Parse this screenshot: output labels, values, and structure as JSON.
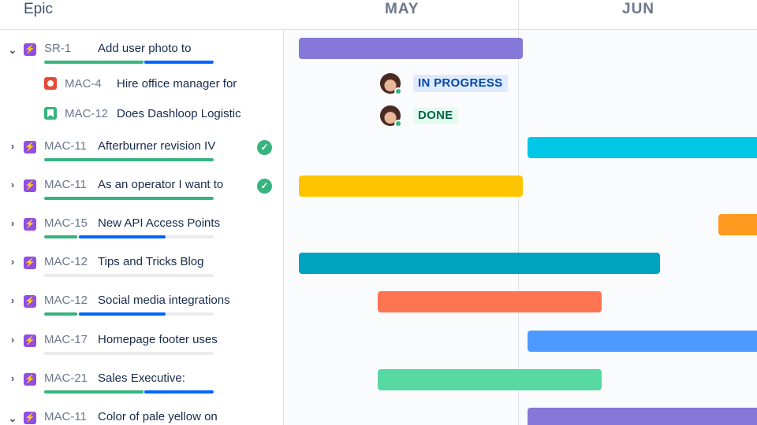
{
  "header": {
    "epic_title": "Epic",
    "months": [
      "MAY",
      "JUN"
    ]
  },
  "colors": {
    "purple": "#8777d9",
    "cyan": "#00c7e6",
    "yellow": "#ffc400",
    "orange": "#ff991f",
    "teal": "#00a3bf",
    "coral": "#ff7452",
    "blue": "#4c9aff",
    "green": "#57d9a3"
  },
  "rows": [
    {
      "key": "SR-1",
      "summary": "Add user photo to",
      "expanded": true,
      "check": false
    },
    {
      "key": "MAC-4",
      "summary": "Hire office manager for",
      "type": "bug",
      "avatar": "avatar",
      "status": "IN PROGRESS"
    },
    {
      "key": "MAC-12",
      "summary": "Does Dashloop Logistic",
      "type": "story",
      "avatar": "avatar",
      "status": "DONE"
    },
    {
      "key": "MAC-11",
      "summary": "Afterburner revision IV",
      "expanded": false,
      "check": true
    },
    {
      "key": "MAC-11",
      "summary": "As an operator I want to",
      "expanded": false,
      "check": true
    },
    {
      "key": "MAC-15",
      "summary": "New API Access Points",
      "expanded": false,
      "check": false
    },
    {
      "key": "MAC-12",
      "summary": "Tips and Tricks Blog",
      "expanded": false,
      "check": false
    },
    {
      "key": "MAC-12",
      "summary": "Social media integrations",
      "expanded": false,
      "check": false
    },
    {
      "key": "MAC-17",
      "summary": "Homepage footer uses",
      "expanded": false,
      "check": false
    },
    {
      "key": "MAC-21",
      "summary": "Sales Executive:",
      "expanded": false,
      "check": false
    },
    {
      "key": "MAC-11",
      "summary": "Color of pale yellow on",
      "expanded": true,
      "check": false
    }
  ],
  "icons": {
    "expanded": "chevron-down-icon",
    "collapsed": "chevron-right-icon",
    "epic": "epic-lightning-icon",
    "bug": "bug-icon",
    "story": "story-bookmark-icon",
    "done_check": "check-circle-icon"
  }
}
